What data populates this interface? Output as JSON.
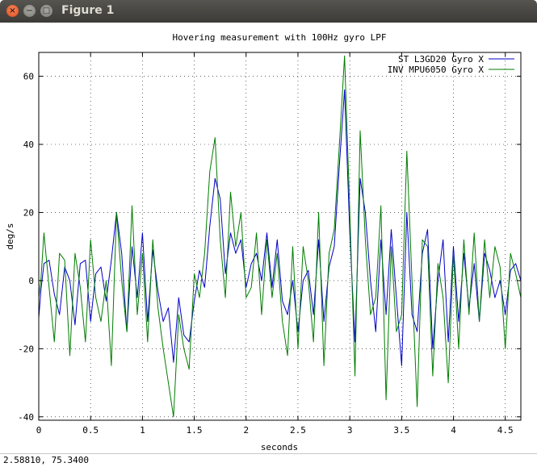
{
  "window": {
    "title": "Figure 1",
    "close_glyph": "×",
    "min_glyph": "−",
    "max_glyph": "□"
  },
  "status": {
    "text": "2.58810,  75.3400"
  },
  "colors": {
    "series1": "#0000c8",
    "series2": "#007d00"
  },
  "chart_data": {
    "type": "line",
    "title": "Hovering measurement with 100Hz gyro LPF",
    "xlabel": "seconds",
    "ylabel": "deg/s",
    "xlim": [
      0,
      4.65
    ],
    "ylim": [
      -41,
      67
    ],
    "grid": true,
    "legend_position": "top-right",
    "xticks": [
      0,
      0.5,
      1,
      1.5,
      2,
      2.5,
      3,
      3.5,
      4,
      4.5
    ],
    "xtick_labels": [
      "0",
      "0.5",
      "1",
      "1.5",
      "2",
      "2.5",
      "3",
      "3.5",
      "4",
      "4.5"
    ],
    "yticks": [
      -40,
      -20,
      0,
      20,
      40,
      60
    ],
    "ytick_labels": [
      "-40",
      "-20",
      "0",
      "20",
      "40",
      "60"
    ],
    "series": [
      {
        "name": "ST L3GD20 Gyro X",
        "color": "#0000c8",
        "x": [
          0,
          0.02,
          0.05,
          0.1,
          0.15,
          0.2,
          0.25,
          0.3,
          0.35,
          0.4,
          0.45,
          0.5,
          0.55,
          0.6,
          0.65,
          0.7,
          0.75,
          0.8,
          0.85,
          0.9,
          0.95,
          1.0,
          1.05,
          1.1,
          1.15,
          1.2,
          1.25,
          1.3,
          1.35,
          1.4,
          1.45,
          1.5,
          1.55,
          1.6,
          1.65,
          1.7,
          1.75,
          1.8,
          1.85,
          1.9,
          1.95,
          2.0,
          2.05,
          2.1,
          2.15,
          2.2,
          2.25,
          2.3,
          2.35,
          2.4,
          2.45,
          2.5,
          2.55,
          2.6,
          2.65,
          2.7,
          2.75,
          2.8,
          2.85,
          2.9,
          2.95,
          3.0,
          3.05,
          3.1,
          3.15,
          3.2,
          3.25,
          3.3,
          3.35,
          3.4,
          3.45,
          3.5,
          3.55,
          3.6,
          3.65,
          3.7,
          3.75,
          3.8,
          3.85,
          3.9,
          3.95,
          4.0,
          4.05,
          4.1,
          4.15,
          4.2,
          4.25,
          4.3,
          4.35,
          4.4,
          4.45,
          4.5,
          4.55,
          4.6,
          4.65
        ],
        "y": [
          -11,
          -3,
          5,
          6,
          -4,
          -10,
          4,
          0,
          -13,
          5,
          6,
          -12,
          2,
          4,
          -6,
          6,
          20,
          8,
          -15,
          10,
          -5,
          14,
          -12,
          9,
          -3,
          -12,
          -8,
          -24,
          -5,
          -16,
          -18,
          -6,
          3,
          -2,
          16,
          30,
          24,
          2,
          14,
          8,
          12,
          -2,
          5,
          8,
          0,
          14,
          -2,
          12,
          -6,
          -10,
          0,
          -15,
          0,
          3,
          -10,
          12,
          -12,
          4,
          10,
          34,
          56,
          14,
          -18,
          30,
          20,
          0,
          -15,
          12,
          -10,
          15,
          -5,
          -25,
          20,
          -10,
          -15,
          8,
          15,
          -20,
          0,
          12,
          -18,
          10,
          -12,
          8,
          -8,
          5,
          -12,
          8,
          3,
          -5,
          0,
          -10,
          3,
          5,
          0
        ]
      },
      {
        "name": "INV MPU6050 Gyro X",
        "color": "#007d00",
        "x": [
          0,
          0.02,
          0.05,
          0.1,
          0.15,
          0.2,
          0.25,
          0.3,
          0.35,
          0.4,
          0.45,
          0.5,
          0.55,
          0.6,
          0.65,
          0.7,
          0.75,
          0.8,
          0.85,
          0.9,
          0.95,
          1.0,
          1.05,
          1.1,
          1.15,
          1.2,
          1.25,
          1.3,
          1.35,
          1.4,
          1.45,
          1.5,
          1.55,
          1.6,
          1.65,
          1.7,
          1.75,
          1.8,
          1.85,
          1.9,
          1.95,
          2.0,
          2.05,
          2.1,
          2.15,
          2.2,
          2.25,
          2.3,
          2.35,
          2.4,
          2.45,
          2.5,
          2.55,
          2.6,
          2.65,
          2.7,
          2.75,
          2.8,
          2.85,
          2.9,
          2.95,
          3.0,
          3.05,
          3.1,
          3.15,
          3.2,
          3.25,
          3.3,
          3.35,
          3.4,
          3.45,
          3.5,
          3.55,
          3.6,
          3.65,
          3.7,
          3.75,
          3.8,
          3.85,
          3.9,
          3.95,
          4.0,
          4.05,
          4.1,
          4.15,
          4.2,
          4.25,
          4.3,
          4.35,
          4.4,
          4.45,
          4.5,
          4.55,
          4.6,
          4.65
        ],
        "y": [
          -5,
          0,
          14,
          -2,
          -18,
          8,
          6,
          -22,
          8,
          -2,
          -18,
          12,
          -5,
          -12,
          0,
          -25,
          20,
          0,
          -15,
          22,
          -10,
          8,
          -18,
          12,
          -8,
          -20,
          -30,
          -40,
          -10,
          -20,
          -26,
          2,
          -5,
          8,
          32,
          42,
          12,
          -5,
          26,
          10,
          20,
          -5,
          -2,
          14,
          -10,
          12,
          -5,
          8,
          -12,
          -22,
          10,
          -20,
          10,
          0,
          -18,
          20,
          -25,
          8,
          15,
          40,
          66,
          20,
          -28,
          44,
          12,
          -10,
          -5,
          22,
          -35,
          10,
          -15,
          -10,
          38,
          0,
          -37,
          12,
          10,
          -28,
          5,
          -5,
          -30,
          8,
          -20,
          12,
          -10,
          14,
          -12,
          12,
          -5,
          10,
          4,
          -20,
          8,
          2,
          -5
        ]
      }
    ]
  }
}
